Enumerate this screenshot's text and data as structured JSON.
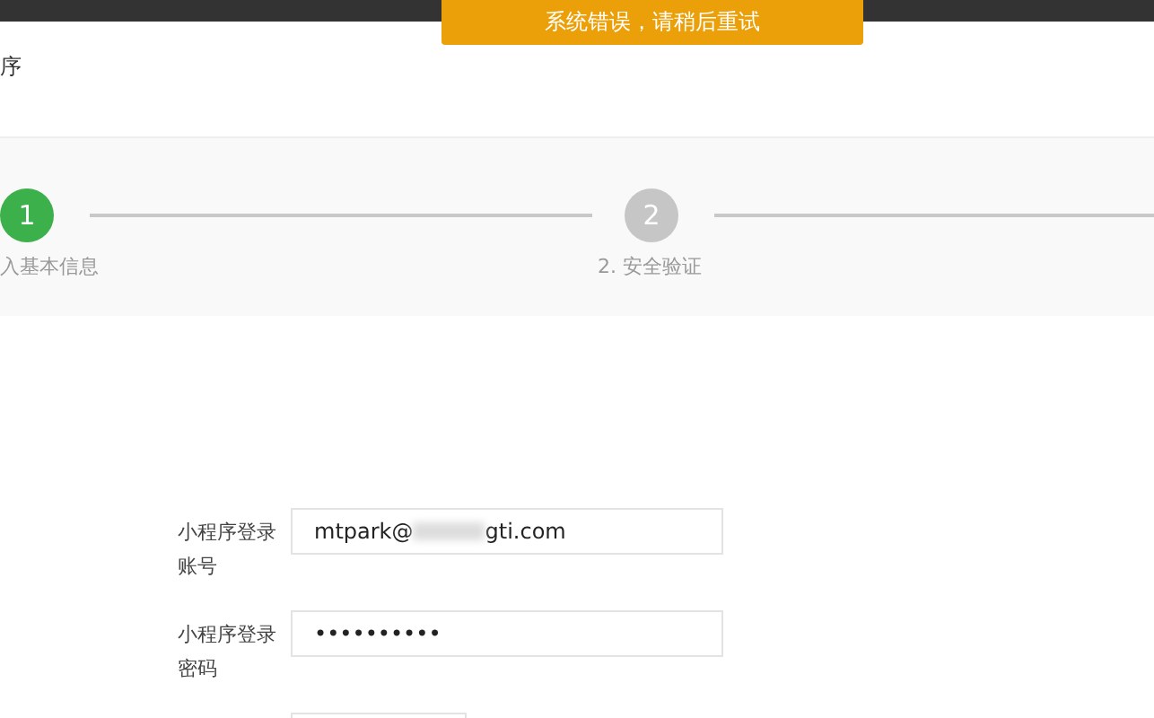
{
  "toast": {
    "message": "系统错误，请稍后重试"
  },
  "page_title": "序",
  "steps": [
    {
      "number": "1",
      "label": "入基本信息",
      "selected": true
    },
    {
      "number": "2",
      "label": "2. 安全验证",
      "selected": false
    }
  ],
  "form": {
    "fields": [
      {
        "label": "小程序登录账号",
        "kind": "text",
        "value_start": "mtpark@",
        "value_end": "gti.com"
      },
      {
        "label": "小程序登录密码",
        "kind": "password",
        "value": "••••••••••"
      },
      {
        "kind": "empty"
      }
    ]
  }
}
